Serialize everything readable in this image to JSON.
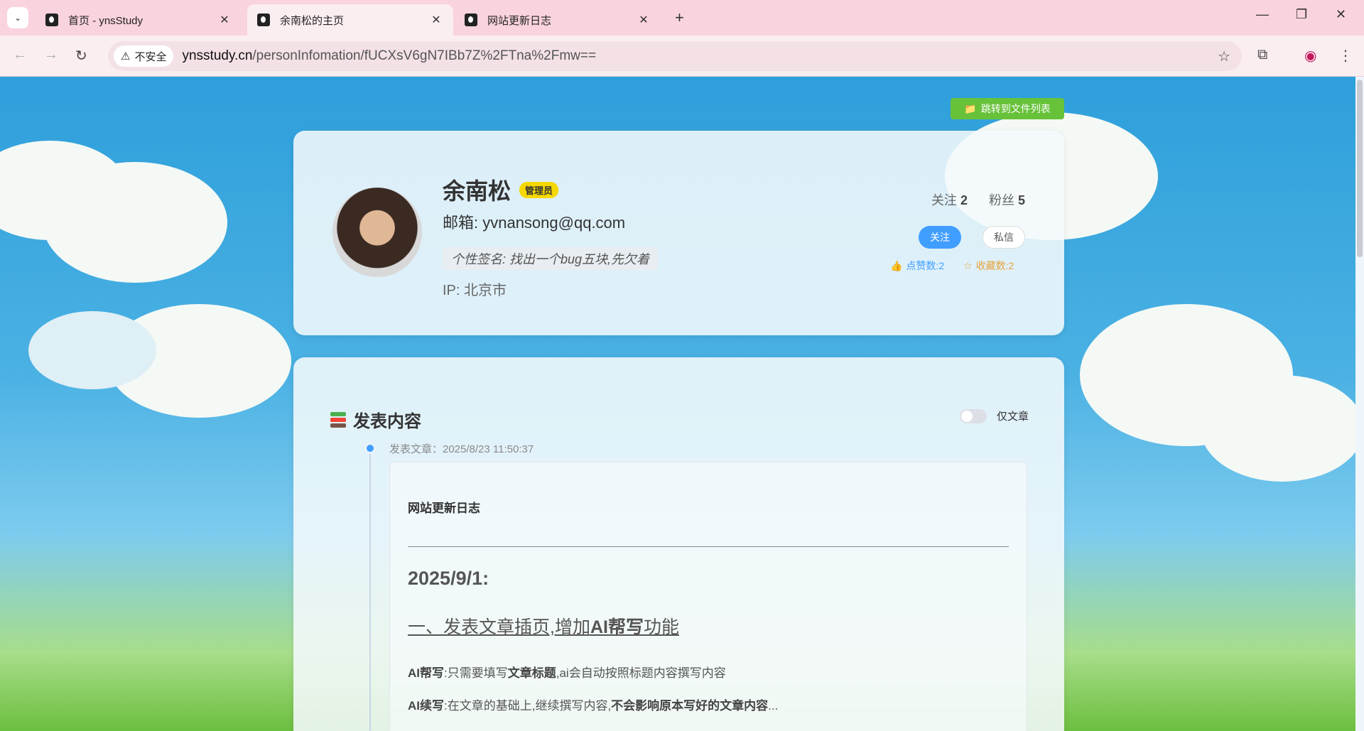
{
  "browser": {
    "tabs": [
      {
        "label": "首页 - ynsStudy",
        "active": false
      },
      {
        "label": "余南松的主页",
        "active": true
      },
      {
        "label": "网站更新日志",
        "active": false
      }
    ],
    "new_tab": "+",
    "insecure_label": "不安全",
    "url_host": "ynsstudy.cn",
    "url_path": "/personInfomation/fUCXsV6gN7IBb7Z%2FTna%2Fmw=="
  },
  "page": {
    "jump_button": "跳转到文件列表",
    "profile": {
      "name": "余南松",
      "role_badge": "管理员",
      "email": "邮箱: yvnansong@qq.com",
      "signature": "个性签名: 找出一个bug五块,先欠着",
      "ip": "IP: 北京市",
      "following_label": "关注",
      "following_count": "2",
      "followers_label": "粉丝",
      "followers_count": "5",
      "follow_button": "关注",
      "message_button": "私信",
      "likes": "点赞数:2",
      "favorites": "收藏数:2"
    },
    "content": {
      "section_title": "发表内容",
      "toggle_label": "仅文章",
      "post": {
        "time": "发表文章：2025/8/23 11:50:37",
        "title": "网站更新日志",
        "date_heading": "2025/9/1:",
        "heading_a": "一、发表文章插页,增加",
        "heading_b": "AI帮写",
        "heading_c": "功能",
        "p1_a": "AI帮写",
        "p1_b": ":只需要填写",
        "p1_c": "文章标题",
        "p1_d": ",ai会自动按照标题内容撰写内容",
        "p2_a": "AI续写",
        "p2_b": ":在文章的基础上,继续撰写内容,",
        "p2_c": "不会影响原本写好的文章内容",
        "p2_d": "..."
      }
    }
  },
  "colors": {
    "accent": "#409eff",
    "jump_green": "#67c23a",
    "badge_yellow": "#f5d800",
    "fav_orange": "#e6a23c",
    "tabbar_pink": "#f9d3dd"
  }
}
